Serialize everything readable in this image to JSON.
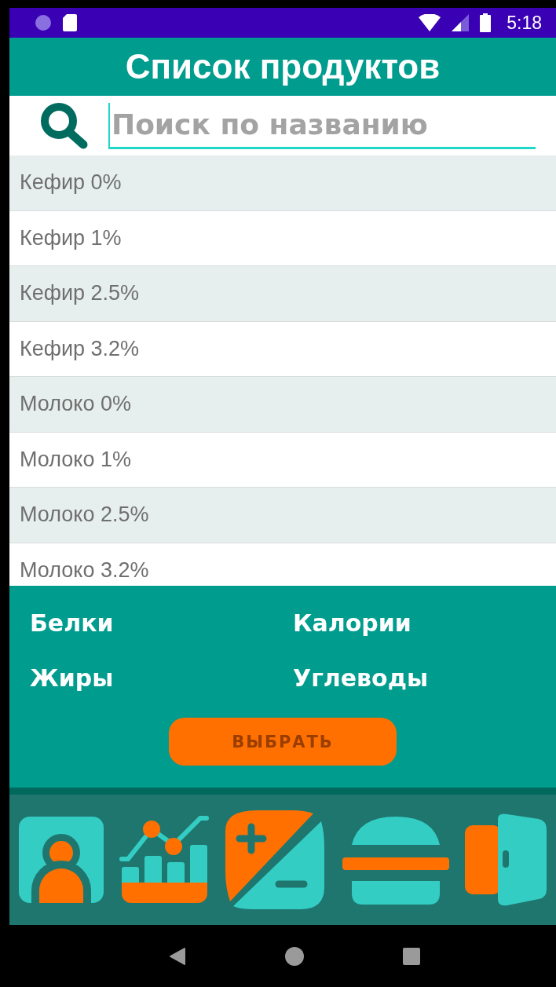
{
  "status_bar": {
    "time": "5:18"
  },
  "title": "Список продуктов",
  "search": {
    "placeholder": "Поиск по названию"
  },
  "products": [
    {
      "name": "Кефир 0%"
    },
    {
      "name": "Кефир 1%"
    },
    {
      "name": "Кефир 2.5%"
    },
    {
      "name": "Кефир 3.2%"
    },
    {
      "name": "Молоко 0%"
    },
    {
      "name": "Молоко 1%"
    },
    {
      "name": "Молоко 2.5%"
    },
    {
      "name": "Молоко 3.2%"
    }
  ],
  "nutrients": [
    "Белки",
    "Калории",
    "Жиры",
    "Углеводы"
  ],
  "select_button": "ВЫБРАТЬ",
  "bottom_nav": [
    {
      "kind": "profile"
    },
    {
      "kind": "stats"
    },
    {
      "kind": "calc"
    },
    {
      "kind": "burger"
    },
    {
      "kind": "exit"
    }
  ]
}
